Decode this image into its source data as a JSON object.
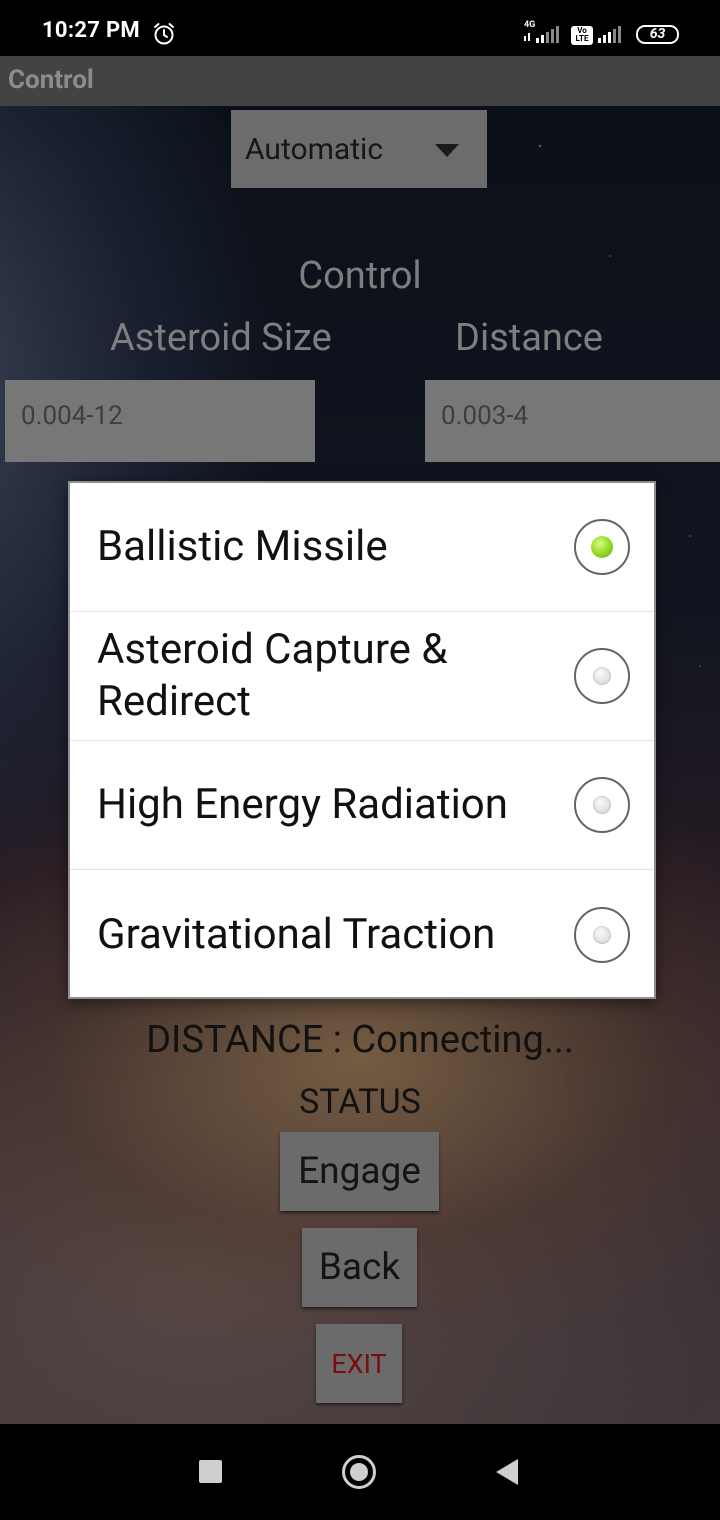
{
  "status_bar": {
    "time": "10:27 PM",
    "network_1": "4G",
    "volte": "Vo LTE",
    "battery": "63"
  },
  "app": {
    "title": "Control",
    "mode_spinner": {
      "selected": "Automatic"
    },
    "heading": "Control",
    "labels": {
      "asteroid_size": "Asteroid Size",
      "distance": "Distance"
    },
    "inputs": {
      "asteroid_size_placeholder": "0.004-12",
      "distance_placeholder": "0.003-4"
    },
    "distance_text": "DISTANCE : Connecting...",
    "status_text": "STATUS",
    "buttons": {
      "engage": "Engage",
      "back": "Back",
      "exit": "EXIT"
    }
  },
  "dialog": {
    "options": [
      {
        "label": "Ballistic Missile",
        "checked": true
      },
      {
        "label": "Asteroid Capture & Redirect",
        "checked": false
      },
      {
        "label": "High Energy Radiation",
        "checked": false
      },
      {
        "label": "Gravitational Traction",
        "checked": false
      }
    ]
  },
  "colors": {
    "radio_checked": "#8ad21e",
    "exit_text": "#7a0c0c"
  },
  "icons": [
    "alarm-icon",
    "signal-icon",
    "battery-icon",
    "nav-recent-icon",
    "nav-home-icon",
    "nav-back-icon",
    "dropdown-arrow-icon"
  ]
}
